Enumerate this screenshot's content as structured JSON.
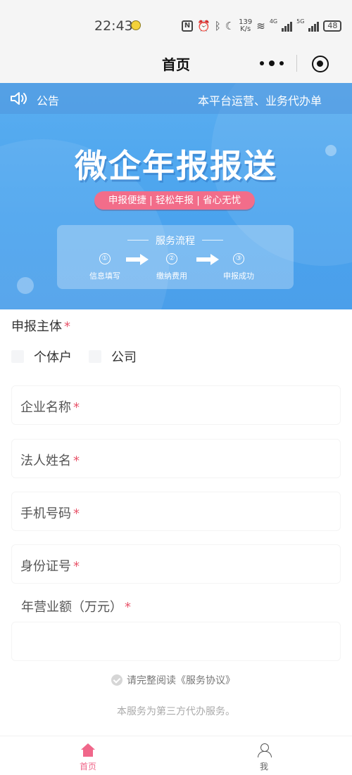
{
  "status_bar": {
    "time": "22:43",
    "speed_value": "139",
    "speed_unit": "K/s",
    "net_4g": "4G",
    "net_5g": "5G",
    "battery": "48"
  },
  "nav": {
    "title": "首页"
  },
  "notice": {
    "label": "公告",
    "text": "本平台运营、业务代办单"
  },
  "banner": {
    "title": "微企年报报送",
    "tagline": "申报便捷 | 轻松年报 | 省心无忧",
    "flow_title": "服务流程",
    "steps": [
      {
        "num": "①",
        "label": "信息填写"
      },
      {
        "num": "②",
        "label": "缴纳费用"
      },
      {
        "num": "③",
        "label": "申报成功"
      }
    ]
  },
  "form": {
    "subject_label": "申报主体",
    "required_mark": "*",
    "options": [
      "个体户",
      "公司"
    ],
    "fields": [
      {
        "label": "企业名称"
      },
      {
        "label": "法人姓名"
      },
      {
        "label": "手机号码"
      },
      {
        "label": "身份证号"
      }
    ],
    "revenue_label": "年营业额（万元）"
  },
  "agreement": {
    "text": "请完整阅读《服务协议》"
  },
  "disclaimer": "本服务为第三方代办服务。",
  "tabs": {
    "home": "首页",
    "me": "我"
  },
  "colors": {
    "accent_pink": "#f0678a",
    "banner_blue": "#4aa3ee",
    "required_red": "#e8546a"
  }
}
